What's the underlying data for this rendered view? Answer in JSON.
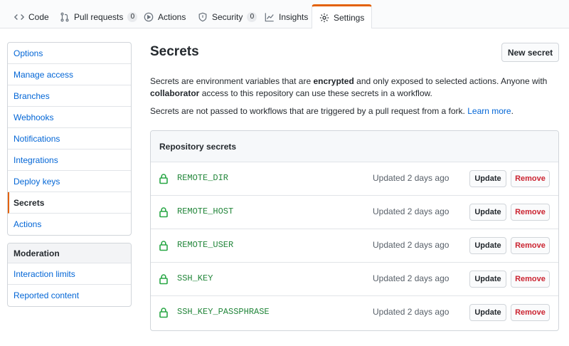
{
  "tabs": [
    {
      "label": "Code",
      "icon": "code-icon"
    },
    {
      "label": "Pull requests",
      "icon": "pull-request-icon",
      "count": "0"
    },
    {
      "label": "Actions",
      "icon": "play-icon"
    },
    {
      "label": "Security",
      "icon": "shield-icon",
      "count": "0"
    },
    {
      "label": "Insights",
      "icon": "graph-icon"
    },
    {
      "label": "Settings",
      "icon": "gear-icon",
      "selected": true
    }
  ],
  "sidebar": {
    "items": [
      {
        "label": "Options"
      },
      {
        "label": "Manage access"
      },
      {
        "label": "Branches"
      },
      {
        "label": "Webhooks"
      },
      {
        "label": "Notifications"
      },
      {
        "label": "Integrations"
      },
      {
        "label": "Deploy keys"
      },
      {
        "label": "Secrets",
        "active": true
      },
      {
        "label": "Actions"
      }
    ],
    "moderation": {
      "heading": "Moderation",
      "items": [
        {
          "label": "Interaction limits"
        },
        {
          "label": "Reported content"
        }
      ]
    }
  },
  "main": {
    "title": "Secrets",
    "new_secret_label": "New secret",
    "description": {
      "part1": "Secrets are environment variables that are ",
      "bold1": "encrypted",
      "part2": " and only exposed to selected actions. Anyone with ",
      "bold2": "collaborator",
      "part3": " access to this repository can use these secrets in a workflow."
    },
    "fork_note": "Secrets are not passed to workflows that are triggered by a pull request from a fork. ",
    "learn_more": "Learn more",
    "period": ".",
    "box_heading": "Repository secrets",
    "update_label": "Update",
    "remove_label": "Remove",
    "secrets": [
      {
        "name": "REMOTE_DIR",
        "updated": "Updated 2 days ago"
      },
      {
        "name": "REMOTE_HOST",
        "updated": "Updated 2 days ago"
      },
      {
        "name": "REMOTE_USER",
        "updated": "Updated 2 days ago"
      },
      {
        "name": "SSH_KEY",
        "updated": "Updated 2 days ago"
      },
      {
        "name": "SSH_KEY_PASSPHRASE",
        "updated": "Updated 2 days ago"
      }
    ]
  },
  "colors": {
    "accent": "#e36209",
    "link": "#0366d6",
    "secret_green": "#22863a",
    "danger": "#cb2431"
  }
}
